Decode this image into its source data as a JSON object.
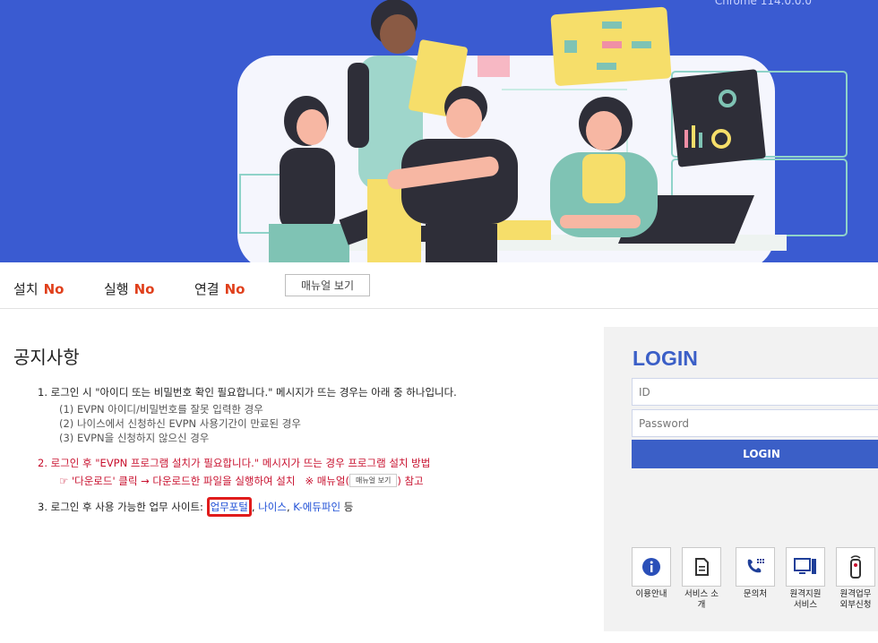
{
  "hero": {
    "version": "Chrome 114.0.0.0"
  },
  "status": [
    {
      "label": "설치",
      "value": "No"
    },
    {
      "label": "실행",
      "value": "No"
    },
    {
      "label": "연결",
      "value": "No"
    }
  ],
  "manual_button": "매뉴얼 보기",
  "notice": {
    "title": "공지사항",
    "item1": "1. 로그인 시 \"아이디 또는 비밀번호 확인 필요합니다.\" 메시지가 뜨는 경우는 아래 중 하나입니다.",
    "item1_sub": [
      "(1) EVPN 아이디/비밀번호를 잘못 입력한 경우",
      "(2) 나이스에서 신청하신 EVPN 사용기간이 만료된 경우",
      "(3) EVPN을 신청하지 않으신 경우"
    ],
    "item2": "2. 로그인 후 \"EVPN 프로그램 설치가 필요합니다.\" 메시지가 뜨는 경우 프로그램 설치 방법",
    "item2_sub_a": "☞ '다운로드' 클릭 → 다운로드한 파일을 실행하여 설치",
    "item2_sub_b": "※ 매뉴얼(",
    "item2_sub_btn": "매뉴얼 보기",
    "item2_sub_c": ") 참고",
    "item3_prefix": "3. 로그인 후 사용 가능한 업무 사이트: ",
    "item3_link1": "업무포털",
    "item3_sep1": ", ",
    "item3_link2": "나이스",
    "item3_sep2": ", ",
    "item3_link3": "K-에듀파인",
    "item3_suffix": " 등"
  },
  "login": {
    "title": "LOGIN",
    "id_placeholder": "ID",
    "pw_placeholder": "Password",
    "button": "LOGIN"
  },
  "quick_links": [
    {
      "label": "이용안내",
      "icon": "info-icon"
    },
    {
      "label": "서비스 소개",
      "icon": "document-icon"
    },
    {
      "label": "문의처",
      "icon": "phone-icon"
    },
    {
      "label": "원격지원 서비스",
      "icon": "monitor-icon"
    },
    {
      "label": "원격업무 외부신청",
      "icon": "remote-icon"
    }
  ],
  "colors": {
    "hero_bg": "#3a5bd1",
    "accent": "#3b5fc7",
    "status_no": "#e0401c",
    "highlight": "#e01c1c"
  }
}
